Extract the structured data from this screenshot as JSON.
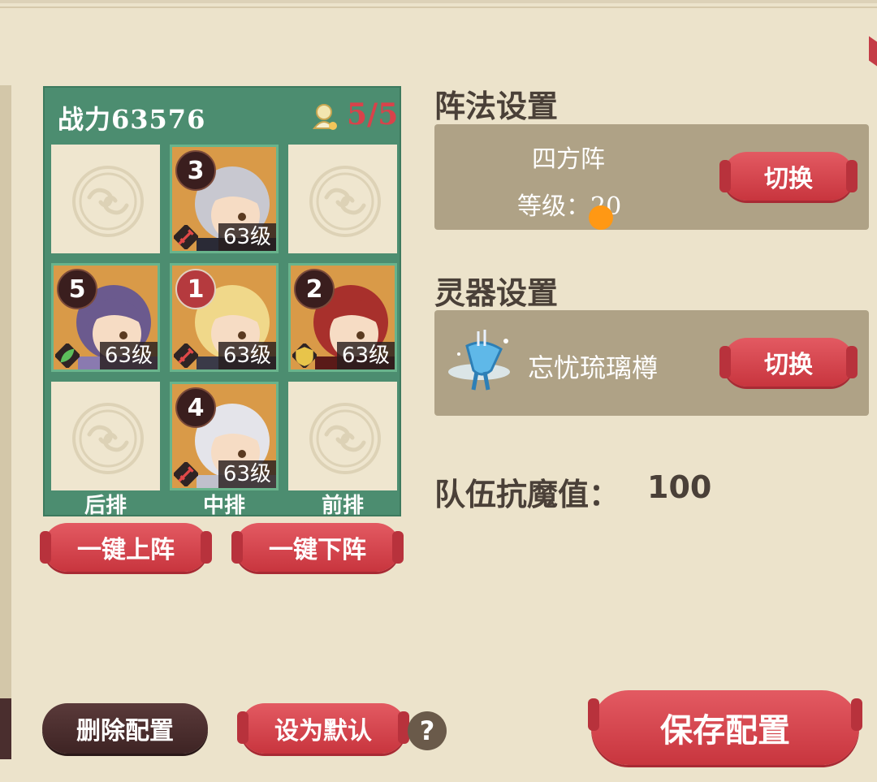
{
  "team": {
    "power_label": "战力63576",
    "count": "5/5",
    "row_labels": [
      "后排",
      "中排",
      "前排"
    ],
    "slots": [
      {
        "filled": false
      },
      {
        "filled": true,
        "order": "3",
        "level": "63级",
        "class": "sword",
        "badge_style": "dark"
      },
      {
        "filled": false
      },
      {
        "filled": true,
        "order": "5",
        "level": "63级",
        "class": "leaf",
        "badge_style": "dark"
      },
      {
        "filled": true,
        "order": "1",
        "level": "63级",
        "class": "sword",
        "badge_style": "red"
      },
      {
        "filled": true,
        "order": "2",
        "level": "63级",
        "class": "shield",
        "badge_style": "dark"
      },
      {
        "filled": false
      },
      {
        "filled": true,
        "order": "4",
        "level": "63级",
        "class": "sword",
        "badge_style": "dark"
      },
      {
        "filled": false
      }
    ]
  },
  "buttons": {
    "deploy_all": "一键上阵",
    "remove_all": "一键下阵",
    "delete_config": "删除配置",
    "set_default": "设为默认",
    "help": "?",
    "save_config": "保存配置"
  },
  "formation": {
    "title": "阵法设置",
    "name": "四方阵",
    "level": "等级：20",
    "switch_label": "切换"
  },
  "artifact": {
    "title": "灵器设置",
    "name": "忘忧琉璃樽",
    "switch_label": "切换"
  },
  "resist": {
    "label": "队伍抗魔值：",
    "value": "100"
  },
  "colors": {
    "background": "#ece3cb",
    "panel_green": "#4c8d70",
    "accent_red": "#d9424a",
    "box_tan": "#afa286"
  }
}
